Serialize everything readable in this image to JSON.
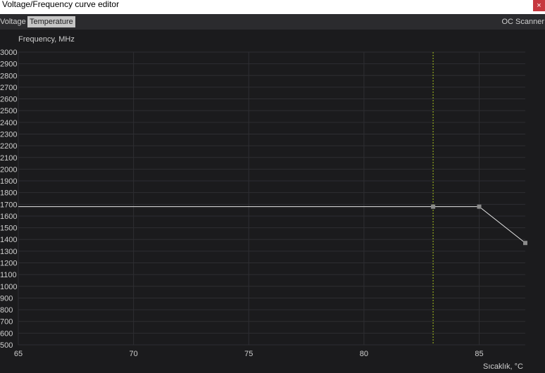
{
  "window": {
    "title": "Voltage/Frequency curve editor",
    "close_glyph": "×"
  },
  "tabs": [
    {
      "label": "Voltage",
      "active": false
    },
    {
      "label": "Temperature",
      "active": true
    }
  ],
  "oc_scanner": {
    "label": "OC Scanner"
  },
  "colors": {
    "background": "#1b1b1d",
    "grid": "#2e2e32",
    "curve": "#e6e6e6",
    "point": "#8a8a8a",
    "marker_line": "#a6c21e",
    "close_button": "#c7383f"
  },
  "chart_data": {
    "type": "line",
    "ylabel": "Frequency, MHz",
    "xlabel": "Sıcaklık, °C",
    "xlim": [
      65,
      87
    ],
    "ylim": [
      500,
      3000
    ],
    "x_ticks": [
      65,
      70,
      75,
      80,
      85
    ],
    "y_ticks": [
      500,
      600,
      700,
      800,
      900,
      1000,
      1100,
      1200,
      1300,
      1400,
      1500,
      1600,
      1700,
      1800,
      1900,
      2000,
      2100,
      2200,
      2300,
      2400,
      2500,
      2600,
      2700,
      2800,
      2900,
      3000
    ],
    "series": [
      {
        "x": [
          65,
          83,
          85,
          87
        ],
        "y": [
          1680,
          1680,
          1680,
          1370
        ]
      }
    ],
    "control_points": [
      {
        "x": 83,
        "y": 1680
      },
      {
        "x": 85,
        "y": 1680
      },
      {
        "x": 87,
        "y": 1370
      }
    ],
    "marker_x": 83,
    "grid": true
  }
}
